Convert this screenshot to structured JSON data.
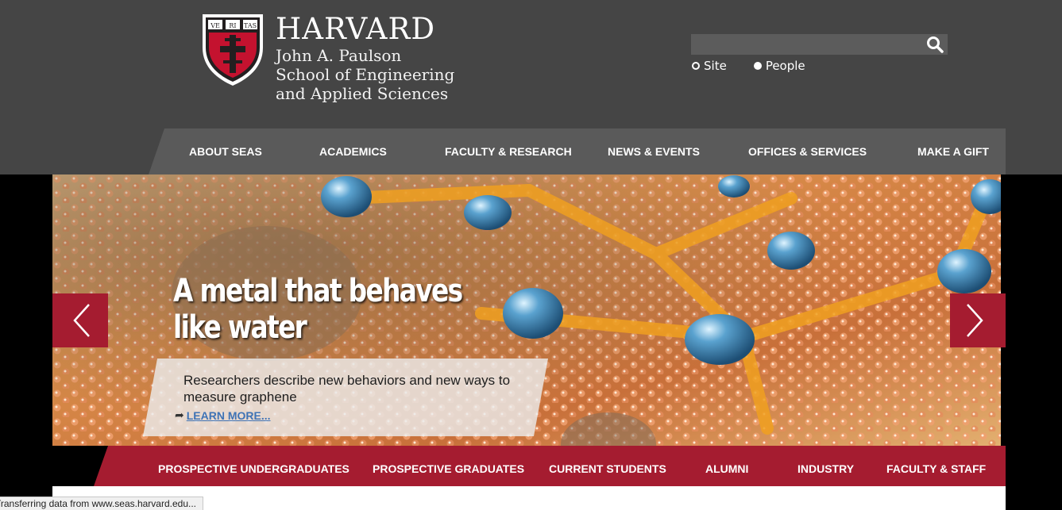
{
  "branding": {
    "name": "HARVARD",
    "school_line1": "John A. Paulson",
    "school_line2": "School of Engineering",
    "school_line3": "and Applied Sciences",
    "shield_motto": [
      "VE",
      "RI",
      "TAS"
    ]
  },
  "search": {
    "value": "",
    "placeholder": "",
    "scopes": [
      {
        "label": "Site",
        "selected": true
      },
      {
        "label": "People",
        "selected": false
      }
    ]
  },
  "main_nav": [
    "ABOUT SEAS",
    "ACADEMICS",
    "FACULTY & RESEARCH",
    "NEWS & EVENTS",
    "OFFICES & SERVICES",
    "MAKE A GIFT"
  ],
  "hero": {
    "headline": "A metal that behaves like water",
    "description": "Researchers describe new behaviors and new ways to measure graphene",
    "link_label": "LEARN MORE..."
  },
  "audience_nav": [
    "PROSPECTIVE UNDERGRADUATES",
    "PROSPECTIVE GRADUATES",
    "CURRENT STUDENTS",
    "ALUMNI",
    "INDUSTRY",
    "FACULTY & STAFF"
  ],
  "status_bar": "Transferring data from www.seas.harvard.edu...",
  "colors": {
    "header_bg": "#454545",
    "nav_bg": "#5a5a5a",
    "crimson": "#a51c30",
    "link_blue": "#3f73b5"
  }
}
